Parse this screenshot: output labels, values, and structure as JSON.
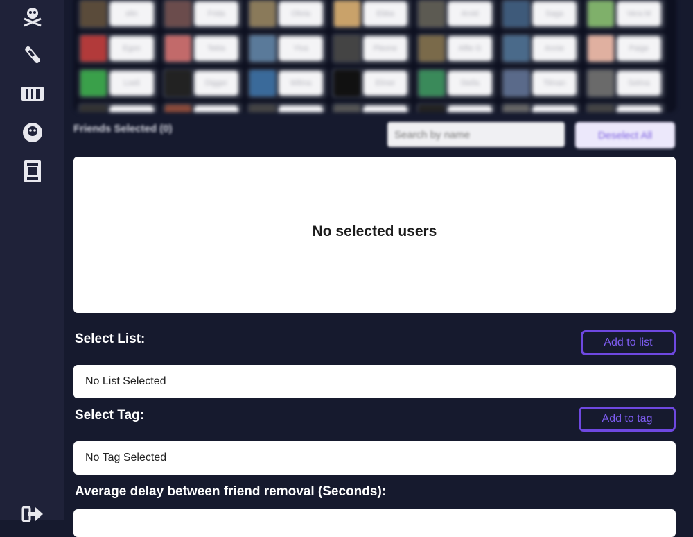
{
  "sidebar": {
    "icons": [
      "skull-crossbones-icon",
      "bottle-icon",
      "ticket-icon",
      "skull-coin-icon",
      "wanted-poster-icon",
      "logout-icon"
    ]
  },
  "friends_grid": {
    "names": [
      "elin",
      "Frida",
      "Olivia",
      "Ebba",
      "Arvid",
      "Saga",
      "Vera M",
      "Egon",
      "Tekla",
      "Ylva",
      "Pleone",
      "Alfie G",
      "Annie",
      "Paige",
      "Loeli",
      "Digger",
      "Wilma",
      "Elmer",
      "Stella",
      "Tilman",
      "Selma",
      "",
      "",
      "",
      "",
      "",
      "",
      ""
    ]
  },
  "selected_section": {
    "title": "Friends Selected (0)",
    "search_placeholder": "Search by name",
    "deselect_label": "Deselect All",
    "empty_text": "No selected users"
  },
  "list_section": {
    "label": "Select List:",
    "button_label": "Add to list",
    "value": "No List Selected"
  },
  "tag_section": {
    "label": "Select Tag:",
    "button_label": "Add to tag",
    "value": "No Tag Selected"
  },
  "delay_section": {
    "label": "Average delay between friend removal (Seconds):"
  },
  "colors": {
    "background": "#161a2e",
    "sidebar": "#1f2239",
    "accent": "#6e48e0"
  }
}
